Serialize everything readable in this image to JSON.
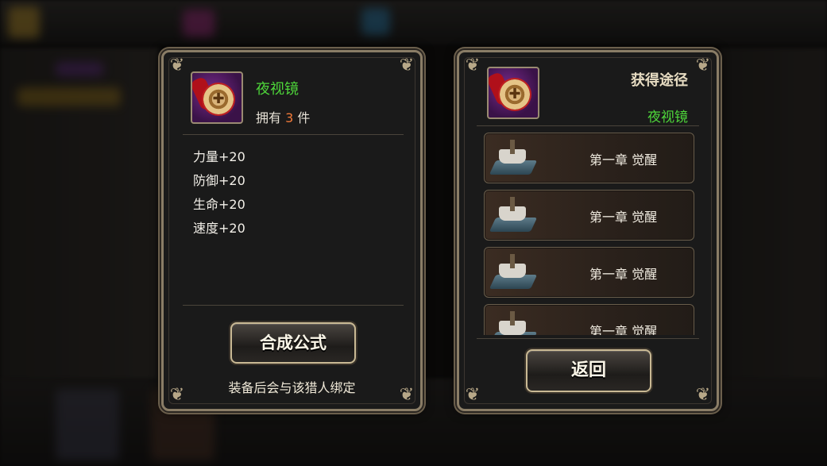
{
  "item": {
    "name": "夜视镜",
    "own_prefix": "拥有",
    "own_count": "3",
    "own_suffix": "件"
  },
  "stats": [
    "力量+20",
    "防御+20",
    "生命+20",
    "速度+20"
  ],
  "left_panel": {
    "compose_button": "合成公式",
    "bind_note": "装备后会与该猎人绑定"
  },
  "right_panel": {
    "title": "获得途径",
    "item_name": "夜视镜",
    "routes": [
      "第一章  觉醒",
      "第一章  觉醒",
      "第一章  觉醒",
      "第一章  觉醒"
    ],
    "back_button": "返回"
  },
  "colors": {
    "item_name": "#4ed63a",
    "count": "#f07a3a",
    "title": "#e7dcc2"
  }
}
